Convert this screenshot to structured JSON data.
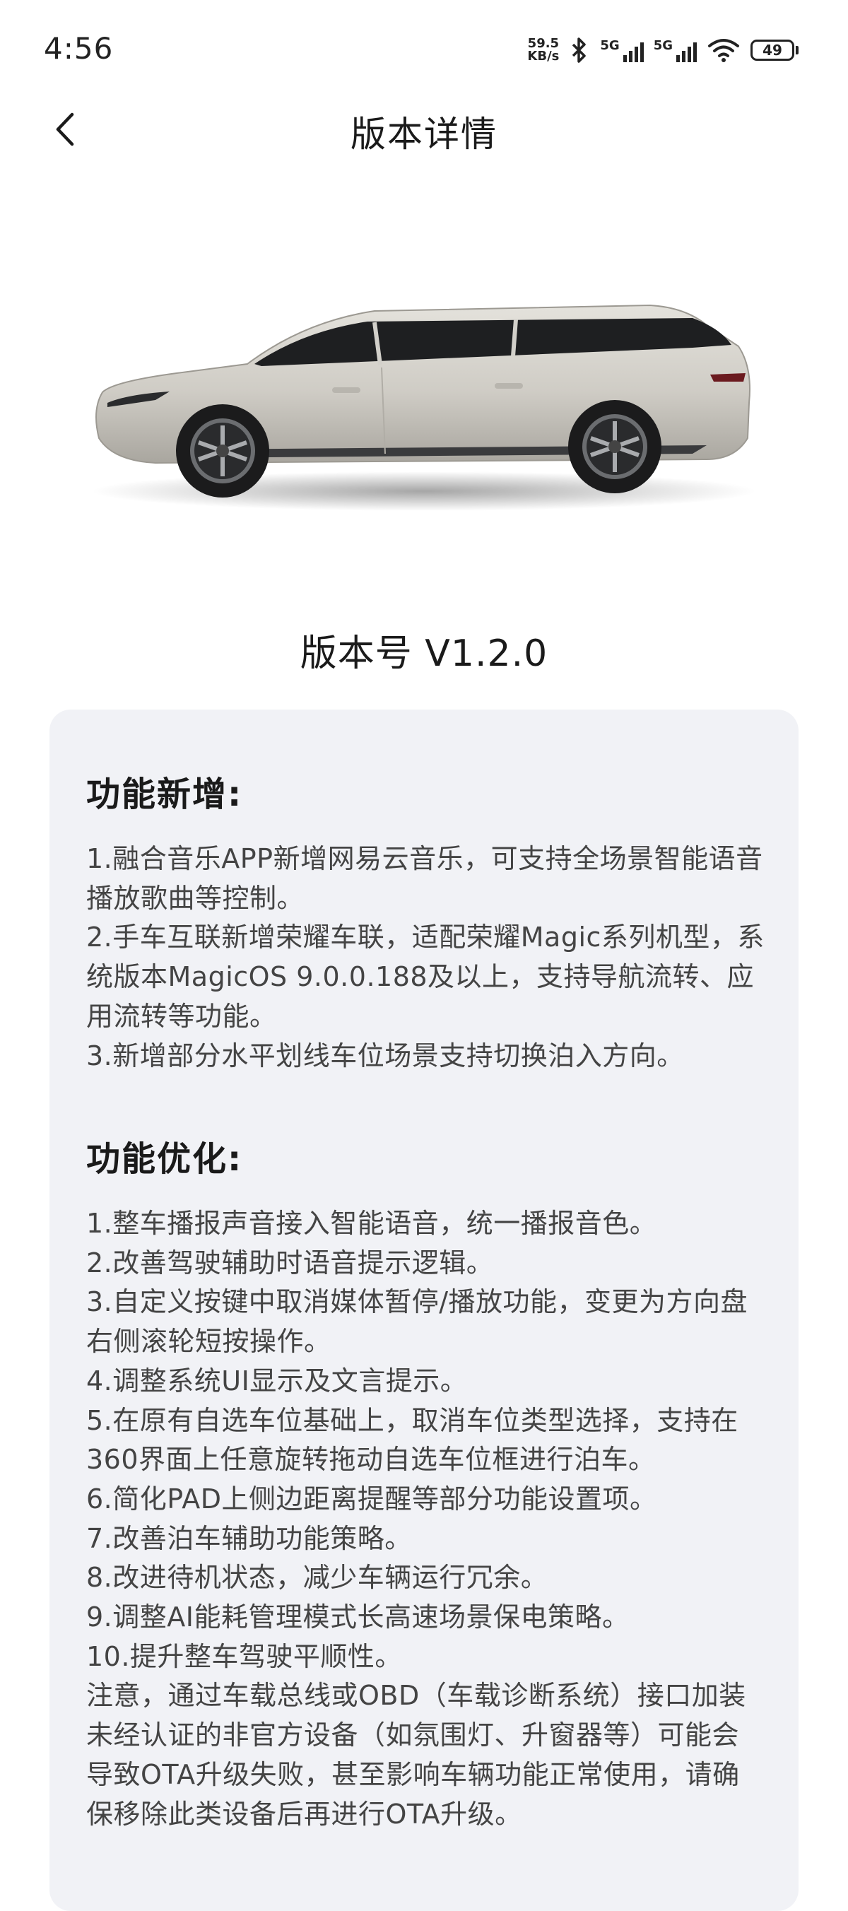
{
  "status_bar": {
    "time": "4:56",
    "net_speed_value": "59.5",
    "net_speed_unit": "KB/s",
    "signal1_label": "5G",
    "signal2_label": "5G",
    "battery": "49"
  },
  "header": {
    "title": "版本详情"
  },
  "version_label": "版本号 V1.2.0",
  "sections": {
    "new_features": {
      "title": "功能新增:",
      "items": [
        "1.融合音乐APP新增网易云音乐，可支持全场景智能语音播放歌曲等控制。",
        "2.手车互联新增荣耀车联，适配荣耀Magic系列机型，系统版本MagicOS 9.0.0.188及以上，支持导航流转、应用流转等功能。",
        "3.新增部分水平划线车位场景支持切换泊入方向。"
      ]
    },
    "optimizations": {
      "title": "功能优化:",
      "items": [
        "1.整车播报声音接入智能语音，统一播报音色。",
        "2.改善驾驶辅助时语音提示逻辑。",
        "3.自定义按键中取消媒体暂停/播放功能，变更为方向盘右侧滚轮短按操作。",
        "4.调整系统UI显示及文言提示。",
        "5.在原有自选车位基础上，取消车位类型选择，支持在360界面上任意旋转拖动自选车位框进行泊车。",
        "6.简化PAD上侧边距离提醒等部分功能设置项。",
        "7.改善泊车辅助功能策略。",
        "8.改进待机状态，减少车辆运行冗余。",
        "9.调整AI能耗管理模式长高速场景保电策略。",
        "10.提升整车驾驶平顺性。",
        "注意，通过车载总线或OBD（车载诊断系统）接口加装未经认证的非官方设备（如氛围灯、升窗器等）可能会导致OTA升级失败，甚至影响车辆功能正常使用，请确保移除此类设备后再进行OTA升级。"
      ]
    }
  },
  "icons": {
    "back": "chevron-left-icon",
    "bluetooth": "bluetooth-icon",
    "wifi": "wifi-icon",
    "battery": "battery-icon"
  },
  "colors": {
    "card_bg": "#f1f2f6",
    "text_primary": "#1a1a1a",
    "text_secondary": "#444444"
  }
}
